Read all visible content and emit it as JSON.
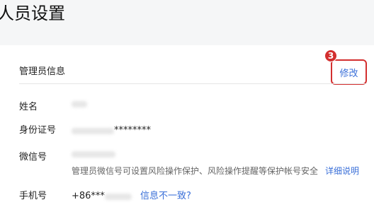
{
  "page": {
    "title": "人员设置"
  },
  "admin_info": {
    "section_title": "管理员信息",
    "edit_label": "修改",
    "step_badge": "3",
    "fields": {
      "name_label": "姓名",
      "id_label": "身份证号",
      "id_value_masked": "********",
      "wechat_label": "微信号",
      "wechat_hint": "管理员微信号可设置风险操作保护、风险操作提醒等保护帐号安全",
      "wechat_hint_link": "详细说明",
      "phone_label": "手机号",
      "phone_prefix": "+86***",
      "phone_mismatch_link": "信息不一致?"
    }
  },
  "colors": {
    "accent_link": "#3a6fd8",
    "highlight_box": "#d32f2f"
  }
}
